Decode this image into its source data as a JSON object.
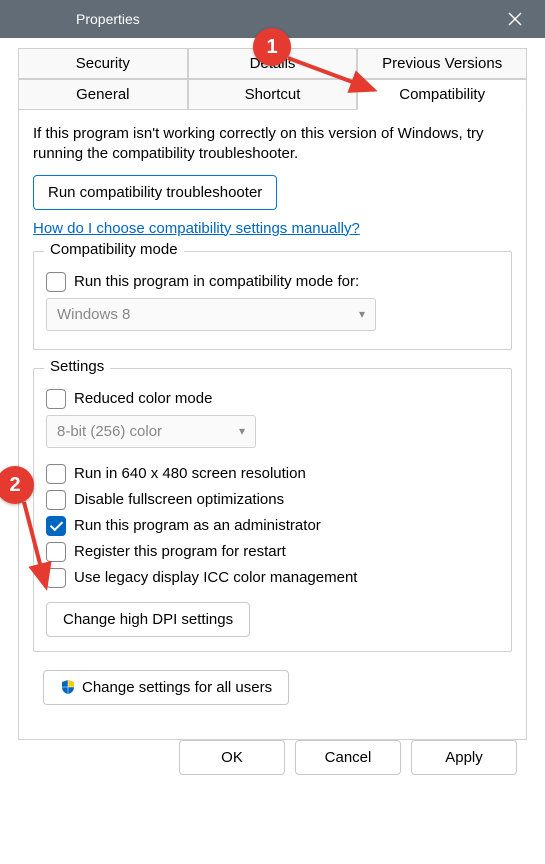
{
  "window": {
    "title": "Properties"
  },
  "tabs": {
    "row1": [
      "Security",
      "Details",
      "Previous Versions"
    ],
    "row2": [
      "General",
      "Shortcut",
      "Compatibility"
    ],
    "active": "Compatibility"
  },
  "intro": "If this program isn't working correctly on this version of Windows, try running the compatibility troubleshooter.",
  "run_troubleshooter": "Run compatibility troubleshooter",
  "help_link": "How do I choose compatibility settings manually?",
  "compat_mode": {
    "title": "Compatibility mode",
    "checkbox_label": "Run this program in compatibility mode for:",
    "select_value": "Windows 8"
  },
  "settings": {
    "title": "Settings",
    "reduced_color": "Reduced color mode",
    "color_select": "8-bit (256) color",
    "run_640": "Run in 640 x 480 screen resolution",
    "disable_fullscreen": "Disable fullscreen optimizations",
    "run_admin": "Run this program as an administrator",
    "register_restart": "Register this program for restart",
    "legacy_icc": "Use legacy display ICC color management",
    "dpi_button": "Change high DPI settings"
  },
  "all_users_button": "Change settings for all users",
  "footer": {
    "ok": "OK",
    "cancel": "Cancel",
    "apply": "Apply"
  },
  "annotations": {
    "marker1": "1",
    "marker2": "2"
  }
}
